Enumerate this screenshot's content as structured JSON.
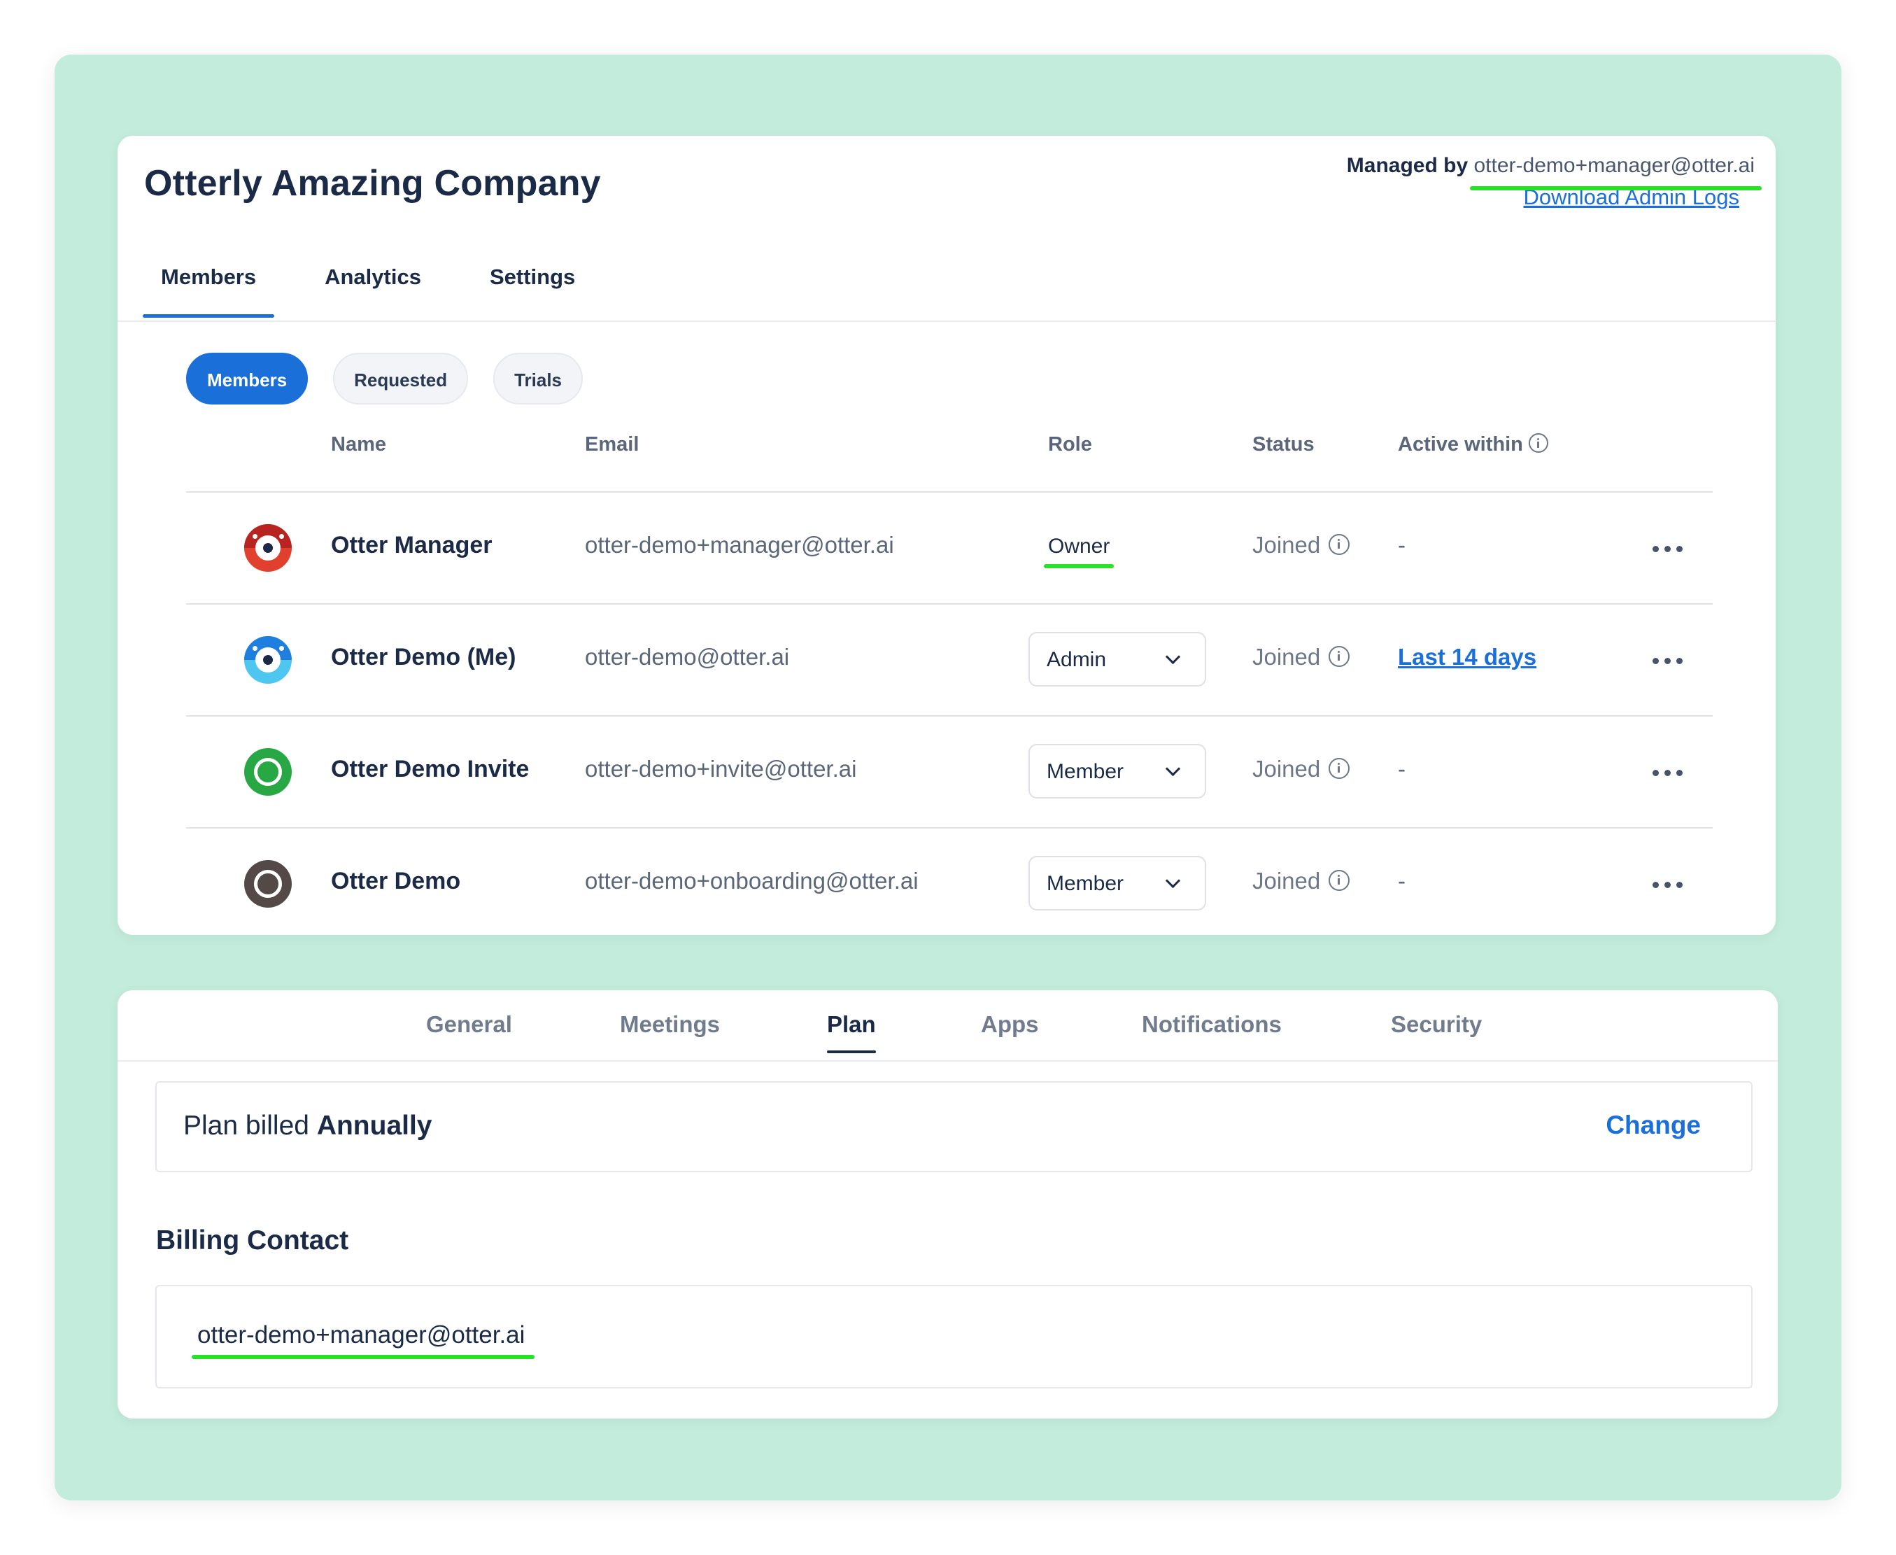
{
  "workspace": {
    "company_name": "Otterly Amazing Company",
    "managed_by_label": "Managed by",
    "managed_by_email": "otter-demo+manager@otter.ai",
    "download_logs_label": "Download Admin Logs"
  },
  "main_tabs": [
    {
      "label": "Members",
      "active": true
    },
    {
      "label": "Analytics",
      "active": false
    },
    {
      "label": "Settings",
      "active": false
    }
  ],
  "filter_pills": [
    {
      "label": "Members",
      "active": true
    },
    {
      "label": "Requested",
      "active": false
    },
    {
      "label": "Trials",
      "active": false
    }
  ],
  "table": {
    "columns": {
      "name": "Name",
      "email": "Email",
      "role": "Role",
      "status": "Status",
      "active_within": "Active within"
    },
    "rows": [
      {
        "name": "Otter Manager",
        "email": "otter-demo+manager@otter.ai",
        "role": "Owner",
        "status": "Joined",
        "active_within": "-"
      },
      {
        "name": "Otter Demo (Me)",
        "email": "otter-demo@otter.ai",
        "role": "Admin",
        "status": "Joined",
        "active_within": "Last 14 days"
      },
      {
        "name": "Otter Demo Invite",
        "email": "otter-demo+invite@otter.ai",
        "role": "Member",
        "status": "Joined",
        "active_within": "-"
      },
      {
        "name": "Otter Demo",
        "email": "otter-demo+onboarding@otter.ai",
        "role": "Member",
        "status": "Joined",
        "active_within": "-"
      }
    ]
  },
  "settings_tabs": [
    {
      "label": "General",
      "active": false
    },
    {
      "label": "Meetings",
      "active": false
    },
    {
      "label": "Plan",
      "active": true
    },
    {
      "label": "Apps",
      "active": false
    },
    {
      "label": "Notifications",
      "active": false
    },
    {
      "label": "Security",
      "active": false
    }
  ],
  "plan": {
    "prefix": "Plan billed",
    "cycle": "Annually",
    "change_label": "Change"
  },
  "billing": {
    "title": "Billing Contact",
    "email": "otter-demo+manager@otter.ai"
  },
  "colors": {
    "backdrop": "#c3ecdc",
    "accent_blue": "#1a6fd8",
    "highlight_green": "#2be02b",
    "text_dark": "#1b2a47"
  }
}
